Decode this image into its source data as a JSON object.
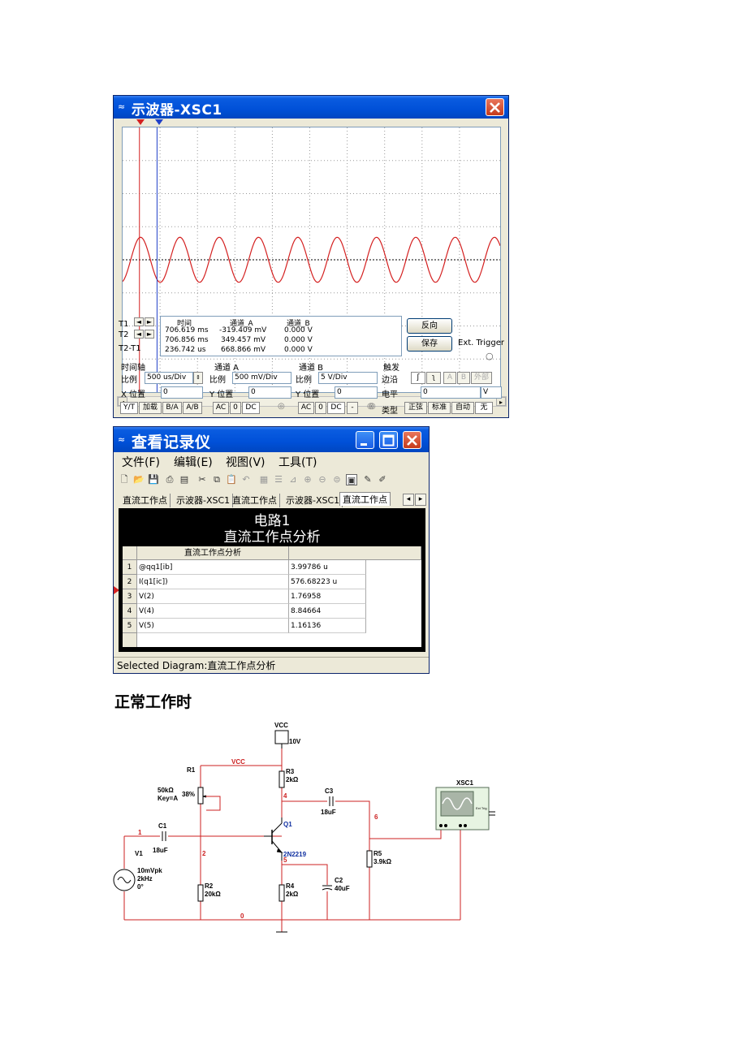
{
  "oscilloscope": {
    "title": "示波器-XSC1",
    "readout": {
      "headers": [
        "时间",
        "通道_A",
        "通道_B"
      ],
      "rows": [
        {
          "label": "T1",
          "time": "706.619 ms",
          "cha": "-319.409 mV",
          "chb": "0.000 V"
        },
        {
          "label": "T2",
          "time": "706.856 ms",
          "cha": "349.457 mV",
          "chb": "0.000 V"
        },
        {
          "label": "T2-T1",
          "time": "236.742 us",
          "cha": "668.866 mV",
          "chb": "0.000 V"
        }
      ]
    },
    "buttons": {
      "reverse": "反向",
      "save": "保存",
      "ext_trigger": "Ext. Trigger"
    },
    "timebase": {
      "group": "时间轴",
      "scale_label": "比例",
      "scale": "500 us/Div",
      "xpos_label": "X 位置",
      "xpos": "0",
      "modes": [
        "Y/T",
        "加载",
        "B/A",
        "A/B"
      ]
    },
    "channel_a": {
      "group": "通道 A",
      "scale_label": "比例",
      "scale": "500 mV/Div",
      "ypos_label": "Y 位置",
      "ypos": "0",
      "coupling": [
        "AC",
        "0",
        "DC"
      ]
    },
    "channel_b": {
      "group": "通道 B",
      "scale_label": "比例",
      "scale": "5  V/Div",
      "ypos_label": "Y 位置",
      "ypos": "0",
      "coupling": [
        "AC",
        "0",
        "DC",
        "-"
      ]
    },
    "trigger": {
      "group": "触发",
      "edge_label": "边沿",
      "level_label": "电平",
      "level": "0",
      "level_unit": "V",
      "type_label": "类型",
      "edges": [
        "A",
        "B",
        "外部"
      ],
      "types": [
        "正弦",
        "标准",
        "自动",
        "无"
      ]
    },
    "waveform": {
      "cycles_visible": 9.6,
      "amplitude_div": 0.68,
      "cursor_t1_div": 0.45,
      "cursor_t2_div": 0.92,
      "color": "#d42020"
    }
  },
  "grapher": {
    "title": "查看记录仪",
    "menu": [
      "文件(F)",
      "编辑(E)",
      "视图(V)",
      "工具(T)"
    ],
    "tabs": [
      "直流工作点",
      "示波器-XSC1",
      "直流工作点",
      "示波器-XSC1",
      "直流工作点"
    ],
    "panel_title": "电路1",
    "panel_subtitle": "直流工作点分析",
    "table": {
      "header": "直流工作点分析",
      "rows": [
        {
          "n": "1",
          "name": "@qq1[ib]",
          "value": "3.99786 u"
        },
        {
          "n": "2",
          "name": "I(q1[ic])",
          "value": "576.68223 u"
        },
        {
          "n": "3",
          "name": "V(2)",
          "value": "1.76958"
        },
        {
          "n": "4",
          "name": "V(4)",
          "value": "8.84664"
        },
        {
          "n": "5",
          "name": "V(5)",
          "value": "1.16136"
        }
      ]
    },
    "status": "Selected Diagram:直流工作点分析"
  },
  "heading": "正常工作时",
  "schematic": {
    "labels": {
      "vcc": "VCC",
      "vcc_val": "10V",
      "vcc_net": "VCC",
      "r1": "R1",
      "r1_val": "50kΩ",
      "r1_key": "Key=A",
      "r1_pct": "38%",
      "r3": "R3",
      "r3_val": "2kΩ",
      "c3": "C3",
      "c3_val": "18uF",
      "c1": "C1",
      "c1_val": "18uF",
      "q1": "Q1",
      "q1_model": "2N2219",
      "v1": "V1",
      "v1_amp": "10mVpk",
      "v1_freq": "2kHz",
      "v1_phase": "0°",
      "r2": "R2",
      "r2_val": "20kΩ",
      "r4": "R4",
      "r4_val": "2kΩ",
      "c2": "C2",
      "c2_val": "40uF",
      "r5": "R5",
      "r5_val": "3.9kΩ",
      "xsc1": "XSC1",
      "ext_trig": "Ext Trig"
    },
    "nodes": {
      "n1": "1",
      "n2": "2",
      "n4": "4",
      "n5": "5",
      "n6": "6",
      "n0": "0"
    }
  }
}
